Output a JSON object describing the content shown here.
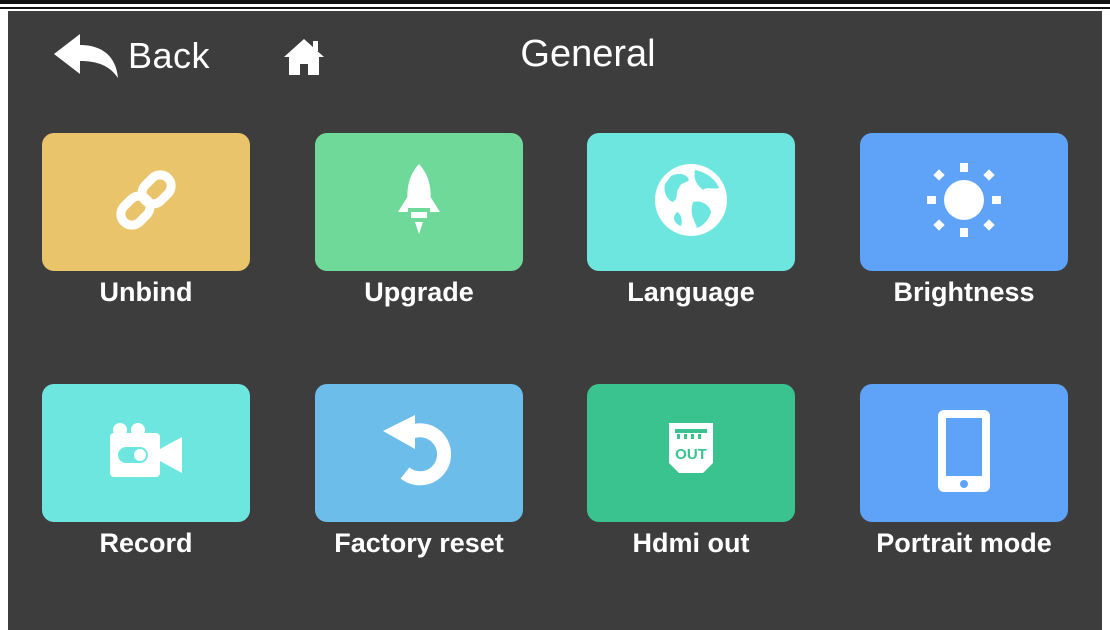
{
  "header": {
    "back_label": "Back",
    "title": "General",
    "back_icon": "back-arrow-icon",
    "home_icon": "home-icon"
  },
  "tiles": [
    {
      "label": "Unbind",
      "icon": "link-icon",
      "color": "#e9c46a"
    },
    {
      "label": "Upgrade",
      "icon": "rocket-icon",
      "color": "#6fd99a"
    },
    {
      "label": "Language",
      "icon": "globe-icon",
      "color": "#6ee6e0"
    },
    {
      "label": "Brightness",
      "icon": "sun-icon",
      "color": "#5ea3f7"
    },
    {
      "label": "Record",
      "icon": "camera-icon",
      "color": "#6ee6e0"
    },
    {
      "label": "Factory reset",
      "icon": "reset-icon",
      "color": "#6cbde9"
    },
    {
      "label": "Hdmi out",
      "icon": "hdmi-out-icon",
      "color": "#3ac38f"
    },
    {
      "label": "Portrait mode",
      "icon": "phone-icon",
      "color": "#5ea3f7"
    }
  ],
  "hdmi_icon_text": "OUT"
}
